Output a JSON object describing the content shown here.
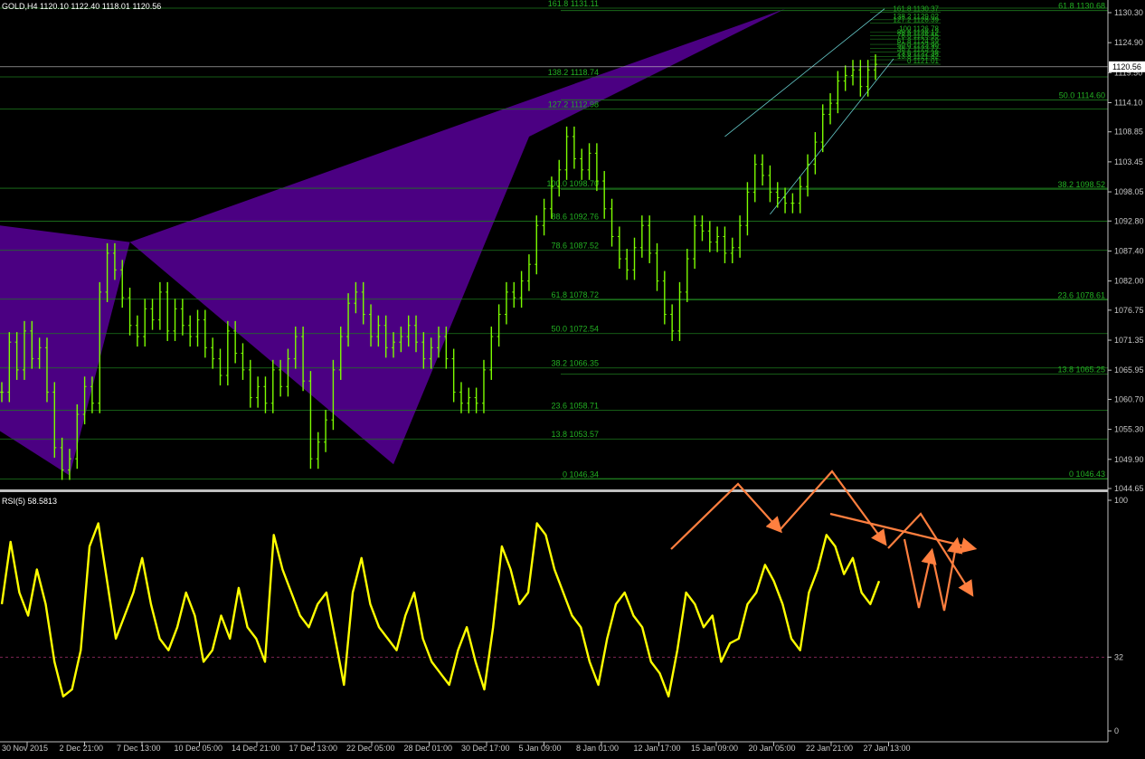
{
  "chart_data": {
    "type": "line",
    "title": "GOLD,H4  1120.10 1122.40 1118.01 1120.56",
    "symbol": "GOLD,H4",
    "ohlc": {
      "open": "1120.10",
      "high": "1122.40",
      "low": "1118.01",
      "close": "1120.56"
    },
    "current_price": "1120.56",
    "price_axis": {
      "ylim": [
        1044.65,
        1130.3
      ],
      "ticks": [
        "1130.30",
        "1124.90",
        "1119.50",
        "1114.10",
        "1108.85",
        "1103.45",
        "1098.05",
        "1092.80",
        "1087.40",
        "1082.00",
        "1076.75",
        "1071.35",
        "1065.95",
        "1060.70",
        "1055.30",
        "1049.90",
        "1044.65"
      ]
    },
    "time_axis": {
      "labels": [
        "30 Nov 2015",
        "2 Dec 21:00",
        "7 Dec 13:00",
        "10 Dec 05:00",
        "14 Dec 21:00",
        "17 Dec 13:00",
        "22 Dec 05:00",
        "28 Dec 01:00",
        "30 Dec 17:00",
        "5 Jan 09:00",
        "8 Jan 01:00",
        "12 Jan 17:00",
        "15 Jan 09:00",
        "20 Jan 05:00",
        "22 Jan 21:00",
        "27 Jan 13:00"
      ]
    },
    "price_series": {
      "name": "",
      "values": [
        1062,
        1071,
        1066,
        1073,
        1068,
        1070,
        1062,
        1052,
        1048,
        1050,
        1058,
        1063,
        1060,
        1080,
        1087,
        1084,
        1079,
        1074,
        1072,
        1077,
        1075,
        1080,
        1073,
        1077,
        1074,
        1072,
        1075,
        1070,
        1068,
        1065,
        1073,
        1069,
        1066,
        1061,
        1063,
        1060,
        1066,
        1063,
        1068,
        1072,
        1064,
        1050,
        1053,
        1057,
        1066,
        1072,
        1078,
        1080,
        1076,
        1072,
        1074,
        1070,
        1071,
        1072,
        1074,
        1071,
        1068,
        1070,
        1072,
        1068,
        1062,
        1060,
        1061,
        1060,
        1066,
        1072,
        1076,
        1080,
        1079,
        1082,
        1085,
        1092,
        1095,
        1099,
        1102,
        1108,
        1104,
        1102,
        1105,
        1100,
        1095,
        1090,
        1086,
        1084,
        1088,
        1092,
        1087,
        1082,
        1076,
        1073,
        1080,
        1086,
        1092,
        1091,
        1089,
        1090,
        1087,
        1088,
        1092,
        1098,
        1103,
        1101,
        1098,
        1097,
        1096,
        1096,
        1099,
        1103,
        1107,
        1112,
        1114,
        1118,
        1119,
        1120,
        1117,
        1120,
        1121
      ],
      "color": "#7cfc00"
    },
    "fibonacci_left": [
      {
        "ratio": "161.8",
        "price": "1131.11"
      },
      {
        "ratio": "138.2",
        "price": "1118.74"
      },
      {
        "ratio": "127.2",
        "price": "1112.98"
      },
      {
        "ratio": "100.0",
        "price": "1098.70"
      },
      {
        "ratio": "88.6",
        "price": "1092.76"
      },
      {
        "ratio": "78.6",
        "price": "1087.52"
      },
      {
        "ratio": "61.8",
        "price": "1078.72"
      },
      {
        "ratio": "50.0",
        "price": "1072.54"
      },
      {
        "ratio": "38.2",
        "price": "1066.35"
      },
      {
        "ratio": "23.6",
        "price": "1058.71"
      },
      {
        "ratio": "13.8",
        "price": "1053.57"
      },
      {
        "ratio": "0",
        "price": "1046.34"
      }
    ],
    "fibonacci_right": [
      {
        "ratio": "61.8",
        "price": "1130.68"
      },
      {
        "ratio": "50.0",
        "price": "1114.60"
      },
      {
        "ratio": "38.2",
        "price": "1098.52"
      },
      {
        "ratio": "23.6",
        "price": "1078.61"
      },
      {
        "ratio": "13.8",
        "price": "1065.25"
      },
      {
        "ratio": "0",
        "price": "1046.43"
      }
    ],
    "fibonacci_small": [
      {
        "ratio": "161.8",
        "price": "1130.37"
      },
      {
        "ratio": "138.2",
        "price": "1129.02"
      },
      {
        "ratio": "127.2",
        "price": "1128.39"
      },
      {
        "ratio": "100",
        "price": "1126.78"
      },
      {
        "ratio": "88.6",
        "price": "1126.12"
      },
      {
        "ratio": "78.6",
        "price": "1125.55"
      },
      {
        "ratio": "61.8",
        "price": "1124.59"
      },
      {
        "ratio": "50.0",
        "price": "1123.90"
      },
      {
        "ratio": "38.2",
        "price": "1123.22"
      },
      {
        "ratio": "23.6",
        "price": "1122.38"
      },
      {
        "ratio": "13.8",
        "price": "1121.82"
      },
      {
        "ratio": "0",
        "price": "1121.01"
      }
    ],
    "harmonic_pattern": {
      "color": "#4b0082",
      "points": [
        [
          0,
          1092
        ],
        [
          17,
          1089
        ],
        [
          52,
          1049
        ],
        [
          104,
          1131
        ]
      ],
      "low_point": [
        9,
        1047
      ],
      "inner": [
        52,
        1113
      ]
    },
    "rsi": {
      "label": "RSI(5) 58.5813",
      "name": "RSI(5)",
      "value": "58.5813",
      "ylim": [
        0,
        100
      ],
      "ticks": [
        "100",
        "32",
        "0"
      ],
      "level": 32,
      "color": "#ffff00",
      "values": [
        55,
        82,
        60,
        50,
        70,
        55,
        30,
        15,
        18,
        35,
        80,
        90,
        65,
        40,
        50,
        60,
        75,
        55,
        40,
        35,
        45,
        60,
        50,
        30,
        35,
        50,
        40,
        62,
        45,
        40,
        30,
        85,
        70,
        60,
        50,
        45,
        55,
        60,
        40,
        20,
        60,
        75,
        55,
        45,
        40,
        35,
        50,
        60,
        40,
        30,
        25,
        20,
        35,
        45,
        30,
        18,
        45,
        80,
        70,
        55,
        60,
        90,
        85,
        70,
        60,
        50,
        45,
        30,
        20,
        40,
        55,
        60,
        50,
        45,
        30,
        25,
        15,
        35,
        60,
        55,
        45,
        50,
        30,
        38,
        40,
        55,
        60,
        72,
        65,
        55,
        40,
        35,
        60,
        70,
        85,
        80,
        68,
        75,
        60,
        55,
        65
      ]
    },
    "arrows": {
      "color": "#ff7f3f"
    }
  }
}
